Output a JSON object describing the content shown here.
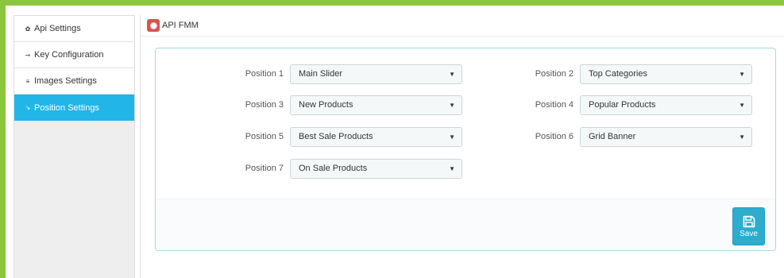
{
  "sidebar": {
    "items": [
      {
        "label": "Api Settings",
        "icon": "gear-icon",
        "active": false
      },
      {
        "label": "Key Configuration",
        "icon": "key-icon",
        "active": false
      },
      {
        "label": "Images Settings",
        "icon": "list-icon",
        "active": false
      },
      {
        "label": "Position Settings",
        "icon": "arrows-icon",
        "active": true
      }
    ]
  },
  "header": {
    "title": "API FMM"
  },
  "positions": [
    {
      "label": "Position 1",
      "value": "Main Slider"
    },
    {
      "label": "Position 2",
      "value": "Top Categories"
    },
    {
      "label": "Position 3",
      "value": "New Products"
    },
    {
      "label": "Position 4",
      "value": "Popular Products"
    },
    {
      "label": "Position 5",
      "value": "Best Sale Products"
    },
    {
      "label": "Position 6",
      "value": "Grid Banner"
    },
    {
      "label": "Position 7",
      "value": "On Sale Products"
    }
  ],
  "save": {
    "label": "Save"
  },
  "colors": {
    "frame": "#8cc63f",
    "active": "#22b5e8",
    "save_button": "#2eacce",
    "logo": "#d9534f"
  }
}
